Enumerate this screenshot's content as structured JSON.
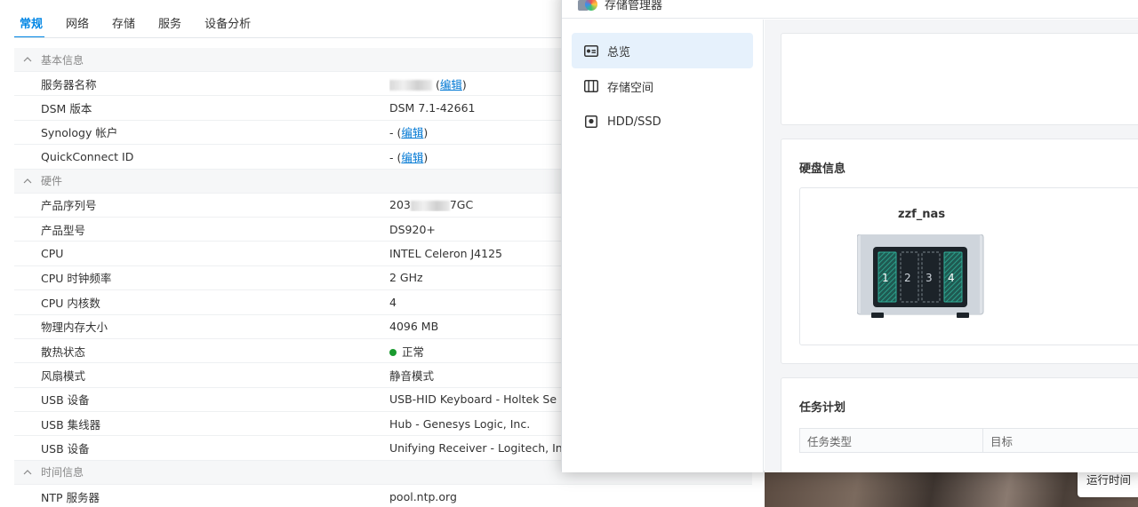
{
  "info_center": {
    "tabs": [
      {
        "label": "常规",
        "active": true
      },
      {
        "label": "网络",
        "active": false
      },
      {
        "label": "存储",
        "active": false
      },
      {
        "label": "服务",
        "active": false
      },
      {
        "label": "设备分析",
        "active": false
      }
    ],
    "sections": [
      {
        "title": "基本信息",
        "rows": [
          {
            "label": "服务器名称",
            "value": "",
            "redacted": true,
            "link": "编辑"
          },
          {
            "label": "DSM 版本",
            "value": "DSM 7.1-42661"
          },
          {
            "label": "Synology 帐户",
            "value": "-",
            "link": "编辑"
          },
          {
            "label": "QuickConnect ID",
            "value": "-",
            "link": "编辑"
          }
        ]
      },
      {
        "title": "硬件",
        "rows": [
          {
            "label": "产品序列号",
            "value_prefix": "203",
            "value_suffix": "7GC",
            "redacted": true
          },
          {
            "label": "产品型号",
            "value": "DS920+"
          },
          {
            "label": "CPU",
            "value": "INTEL Celeron J4125"
          },
          {
            "label": "CPU 时钟频率",
            "value": "2 GHz"
          },
          {
            "label": "CPU 内核数",
            "value": "4"
          },
          {
            "label": "物理内存大小",
            "value": "4096 MB"
          },
          {
            "label": "散热状态",
            "value": "正常",
            "status": "ok"
          },
          {
            "label": "风扇模式",
            "value": "静音模式"
          },
          {
            "label": "USB 设备",
            "value": "USB-HID Keyboard - Holtek Se"
          },
          {
            "label": "USB 集线器",
            "value": "Hub - Genesys Logic, Inc."
          },
          {
            "label": "USB 设备",
            "value": "Unifying Receiver - Logitech, In"
          }
        ]
      },
      {
        "title": "时间信息",
        "rows": [
          {
            "label": "NTP 服务器",
            "value": "pool.ntp.org"
          }
        ]
      }
    ]
  },
  "storage_manager": {
    "title": "存储管理器",
    "nav": [
      {
        "label": "总览",
        "icon": "overview-icon",
        "active": true
      },
      {
        "label": "存储空间",
        "icon": "storage-pool-icon",
        "active": false
      },
      {
        "label": "HDD/SSD",
        "icon": "hdd-icon",
        "active": false
      }
    ],
    "disk_card": {
      "title": "硬盘信息",
      "nas_name": "zzf_nas",
      "bays": [
        {
          "label": "1",
          "occupied": true
        },
        {
          "label": "2",
          "occupied": false
        },
        {
          "label": "3",
          "occupied": false
        },
        {
          "label": "4",
          "occupied": true
        }
      ]
    },
    "task_card": {
      "title": "任务计划",
      "columns": [
        "任务类型",
        "目标"
      ]
    }
  },
  "runtime_label": "运行时间",
  "colors": {
    "accent": "#0086e5",
    "ok": "#1a9a2f",
    "bay_occupied": "#1f8a7a"
  }
}
